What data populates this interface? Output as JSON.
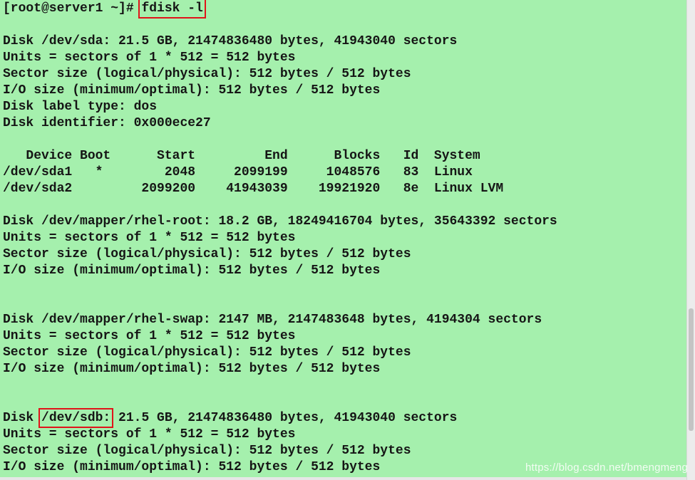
{
  "colors": {
    "background": "#a5f0ad",
    "text": "#151515",
    "highlight_box": "#e0141a"
  },
  "terminal": {
    "prompt": "[root@server1 ~]# ",
    "command": "fdisk -l",
    "sda": {
      "disk_line": "Disk /dev/sda: 21.5 GB, 21474836480 bytes, 41943040 sectors",
      "units": "Units = sectors of 1 * 512 = 512 bytes",
      "sector_size": "Sector size (logical/physical): 512 bytes / 512 bytes",
      "io_size": "I/O size (minimum/optimal): 512 bytes / 512 bytes",
      "label_type": "Disk label type: dos",
      "identifier": "Disk identifier: 0x000ece27"
    },
    "partition_table": {
      "header": "   Device Boot      Start         End      Blocks   Id  System",
      "rows": [
        "/dev/sda1   *        2048     2099199     1048576   83  Linux",
        "/dev/sda2         2099200    41943039    19921920   8e  Linux LVM"
      ]
    },
    "rhel_root": {
      "disk_line": "Disk /dev/mapper/rhel-root: 18.2 GB, 18249416704 bytes, 35643392 sectors",
      "units": "Units = sectors of 1 * 512 = 512 bytes",
      "sector_size": "Sector size (logical/physical): 512 bytes / 512 bytes",
      "io_size": "I/O size (minimum/optimal): 512 bytes / 512 bytes"
    },
    "rhel_swap": {
      "disk_line": "Disk /dev/mapper/rhel-swap: 2147 MB, 2147483648 bytes, 4194304 sectors",
      "units": "Units = sectors of 1 * 512 = 512 bytes",
      "sector_size": "Sector size (logical/physical): 512 bytes / 512 bytes",
      "io_size": "I/O size (minimum/optimal): 512 bytes / 512 bytes"
    },
    "sdb": {
      "disk_prefix": "Disk ",
      "disk_name": "/dev/sdb:",
      "disk_rest": " 21.5 GB, 21474836480 bytes, 41943040 sectors",
      "units": "Units = sectors of 1 * 512 = 512 bytes",
      "sector_size": "Sector size (logical/physical): 512 bytes / 512 bytes",
      "io_size": "I/O size (minimum/optimal): 512 bytes / 512 bytes"
    }
  },
  "watermark": "https://blog.csdn.net/bmengmeng"
}
